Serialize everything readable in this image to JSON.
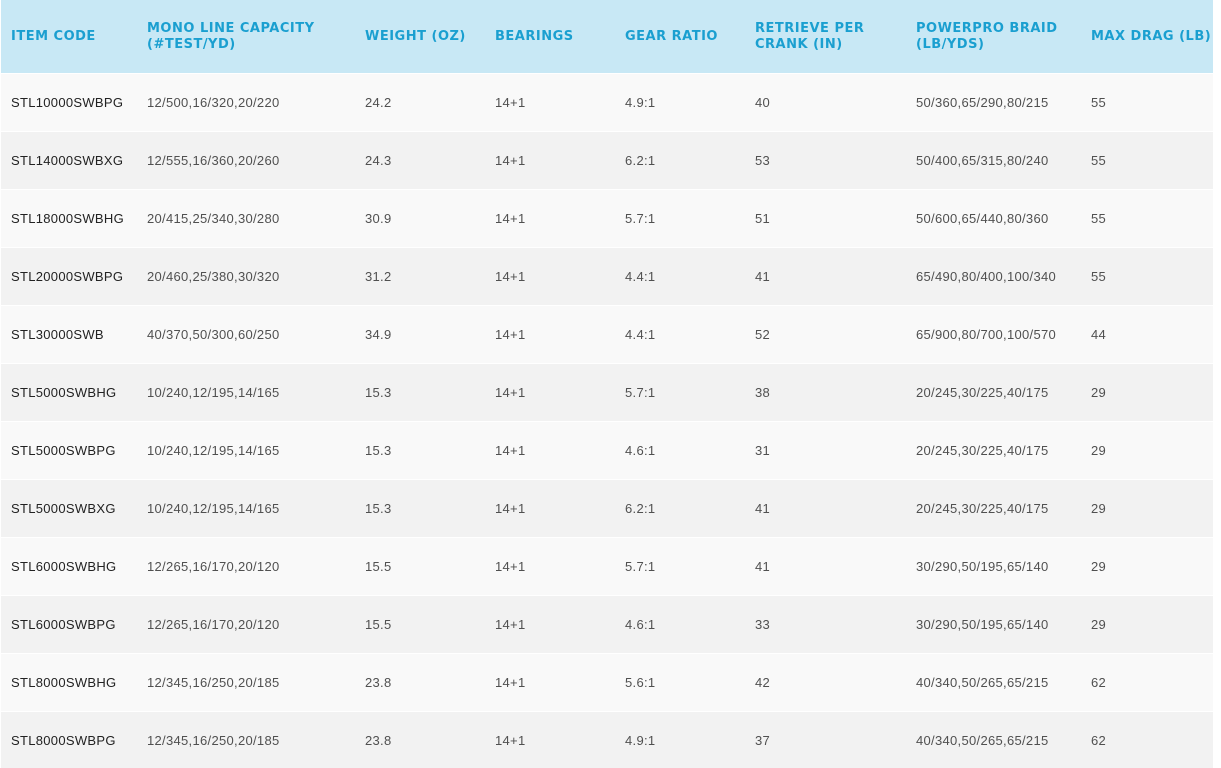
{
  "table": {
    "headers": [
      "ITEM CODE",
      "MONO LINE CAPACITY (#TEST/YD)",
      "WEIGHT (OZ)",
      "BEARINGS",
      "GEAR RATIO",
      "RETRIEVE PER CRANK (IN)",
      "POWERPRO BRAID (LB/YDS)",
      "MAX DRAG (LB)"
    ],
    "rows": [
      [
        "STL10000SWBPG",
        "12/500,16/320,20/220",
        "24.2",
        "14+1",
        "4.9:1",
        "40",
        "50/360,65/290,80/215",
        "55"
      ],
      [
        "STL14000SWBXG",
        "12/555,16/360,20/260",
        "24.3",
        "14+1",
        "6.2:1",
        "53",
        "50/400,65/315,80/240",
        "55"
      ],
      [
        "STL18000SWBHG",
        "20/415,25/340,30/280",
        "30.9",
        "14+1",
        "5.7:1",
        "51",
        "50/600,65/440,80/360",
        "55"
      ],
      [
        "STL20000SWBPG",
        "20/460,25/380,30/320",
        "31.2",
        "14+1",
        "4.4:1",
        "41",
        "65/490,80/400,100/340",
        "55"
      ],
      [
        "STL30000SWB",
        "40/370,50/300,60/250",
        "34.9",
        "14+1",
        "4.4:1",
        "52",
        "65/900,80/700,100/570",
        "44"
      ],
      [
        "STL5000SWBHG",
        "10/240,12/195,14/165",
        "15.3",
        "14+1",
        "5.7:1",
        "38",
        "20/245,30/225,40/175",
        "29"
      ],
      [
        "STL5000SWBPG",
        "10/240,12/195,14/165",
        "15.3",
        "14+1",
        "4.6:1",
        "31",
        "20/245,30/225,40/175",
        "29"
      ],
      [
        "STL5000SWBXG",
        "10/240,12/195,14/165",
        "15.3",
        "14+1",
        "6.2:1",
        "41",
        "20/245,30/225,40/175",
        "29"
      ],
      [
        "STL6000SWBHG",
        "12/265,16/170,20/120",
        "15.5",
        "14+1",
        "5.7:1",
        "41",
        "30/290,50/195,65/140",
        "29"
      ],
      [
        "STL6000SWBPG",
        "12/265,16/170,20/120",
        "15.5",
        "14+1",
        "4.6:1",
        "33",
        "30/290,50/195,65/140",
        "29"
      ],
      [
        "STL8000SWBHG",
        "12/345,16/250,20/185",
        "23.8",
        "14+1",
        "5.6:1",
        "42",
        "40/340,50/265,65/215",
        "62"
      ],
      [
        "STL8000SWBPG",
        "12/345,16/250,20/185",
        "23.8",
        "14+1",
        "4.9:1",
        "37",
        "40/340,50/265,65/215",
        "62"
      ]
    ]
  },
  "colors": {
    "header_bg": "#c8e8f5",
    "header_text": "#1a9fd0",
    "row_odd_bg": "#f9f9f9",
    "row_even_bg": "#f2f2f2",
    "cell_text": "#505050"
  }
}
